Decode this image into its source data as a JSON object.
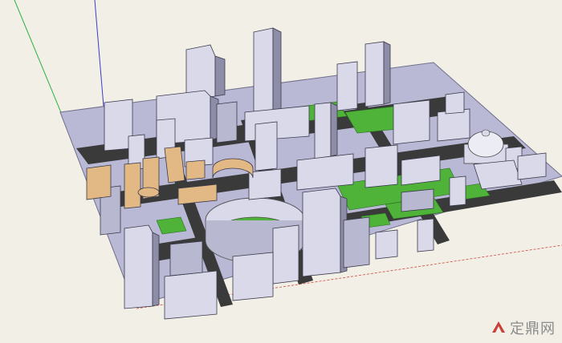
{
  "scene": {
    "kind": "3D city block model in modeling viewport",
    "colors": {
      "background": "#f1efe6",
      "ground": "#b9b9d6",
      "building_face_light": "#d9d9ea",
      "building_face_mid": "#b8b8d0",
      "building_face_dark": "#8d8da8",
      "highlight_buildings": "#e2b985",
      "grass": "#4fb33a",
      "road": "#3a3a3a",
      "axis_green": "#2db043",
      "axis_blue": "#3b3bd1",
      "axis_red": "#d04a3c"
    }
  },
  "watermark": {
    "text": "定鼎网",
    "logo": "ding-logo-icon"
  }
}
